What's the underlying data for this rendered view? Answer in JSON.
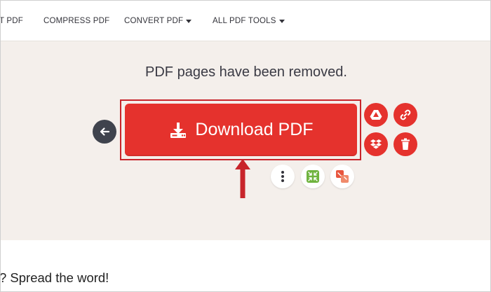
{
  "nav": {
    "items": [
      {
        "label": "T PDF",
        "dropdown": false
      },
      {
        "label": "COMPRESS PDF",
        "dropdown": false
      },
      {
        "label": "CONVERT PDF",
        "dropdown": true
      },
      {
        "label": "ALL PDF TOOLS",
        "dropdown": true
      }
    ]
  },
  "result": {
    "title": "PDF pages have been removed.",
    "download_label": "Download PDF"
  },
  "icons": {
    "back": "arrow-left-icon",
    "download": "download-icon",
    "drive": "google-drive-icon",
    "link": "link-icon",
    "dropbox": "dropbox-icon",
    "delete": "trash-icon",
    "more": "more-vertical-icon",
    "compress": "compress-icon",
    "split": "split-icon"
  },
  "colors": {
    "accent": "#e5322d",
    "outline": "#c8252b",
    "background": "#f4efeb",
    "compress": "#6fb33e",
    "split": "#e8563e"
  },
  "footer": {
    "spread": "? Spread the word!"
  }
}
